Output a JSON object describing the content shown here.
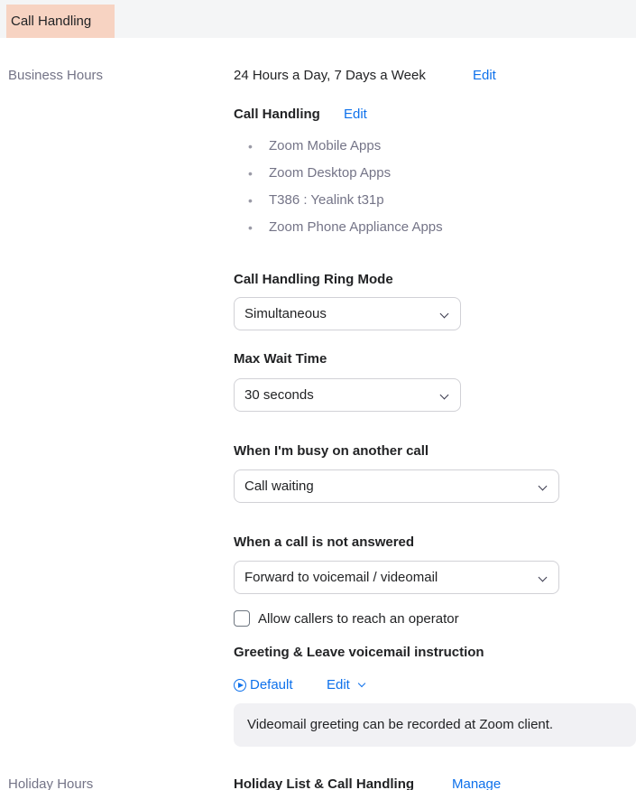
{
  "header": {
    "title": "Call Handling"
  },
  "business_hours": {
    "label": "Business Hours",
    "value": "24 Hours a Day, 7 Days a Week",
    "edit_label": "Edit"
  },
  "call_handling": {
    "title": "Call Handling",
    "edit_label": "Edit",
    "bullet": "•",
    "devices": [
      "Zoom Mobile Apps",
      "Zoom Desktop Apps",
      "T386 : Yealink t31p",
      "Zoom Phone Appliance Apps"
    ]
  },
  "ring_mode": {
    "label": "Call Handling Ring Mode",
    "selected": "Simultaneous"
  },
  "max_wait": {
    "label": "Max Wait Time",
    "selected": "30 seconds"
  },
  "busy": {
    "label": "When I'm busy on another call",
    "selected": "Call waiting"
  },
  "not_answered": {
    "label": "When a call is not answered",
    "selected": "Forward to voicemail / videomail"
  },
  "operator": {
    "label": "Allow callers to reach an operator",
    "checked": false
  },
  "greeting": {
    "label": "Greeting & Leave voicemail instruction",
    "default_label": "Default",
    "edit_label": "Edit",
    "info": "Videomail greeting can be recorded at Zoom client."
  },
  "holiday_hours": {
    "label": "Holiday Hours",
    "list_label": "Holiday List & Call Handling",
    "manage_label": "Manage"
  },
  "colors": {
    "accent": "#0e71eb",
    "header_tab": "#f7d3c2",
    "muted_text": "#747487"
  },
  "icons": {
    "dropdown": "chevron-down-icon",
    "play": "play-circle-icon",
    "checkbox": "checkbox-icon"
  }
}
